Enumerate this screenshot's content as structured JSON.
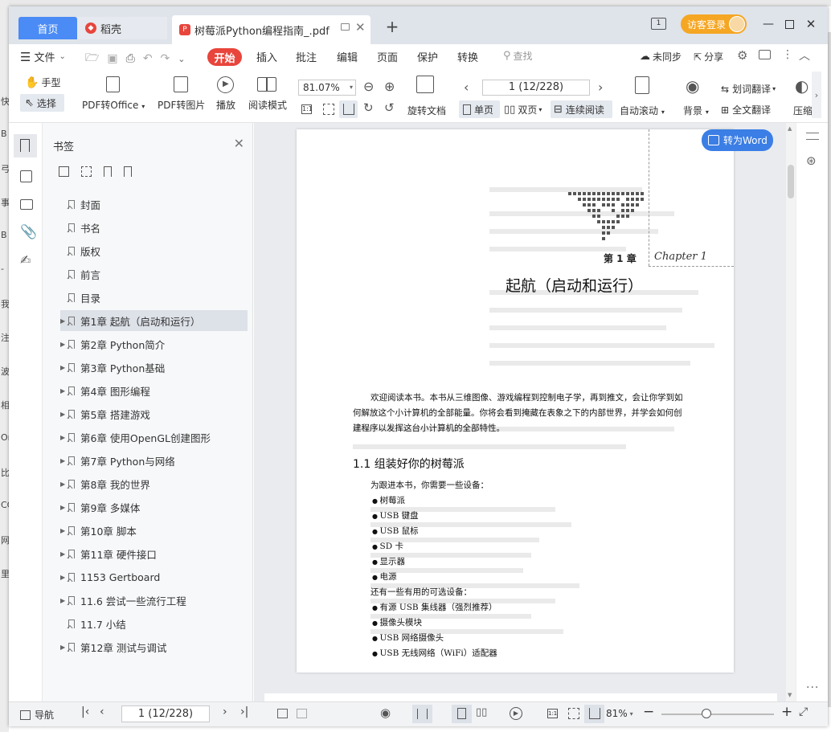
{
  "background": {
    "title_fragment": "树莓派Python编程指南",
    "side_chars": [
      "快",
      "B",
      "弓",
      "事",
      "B",
      "-",
      "我",
      "注",
      "波",
      "相",
      "Or",
      "比",
      "CC",
      "网",
      "里"
    ]
  },
  "tabs": {
    "home": "首页",
    "docer": "稻壳",
    "pdf": "树莓派Python编程指南_.pdf"
  },
  "account": {
    "visitor_label": "访客登录"
  },
  "menu": {
    "file": "文件",
    "start": "开始",
    "insert": "插入",
    "annotate": "批注",
    "edit": "编辑",
    "page": "页面",
    "protect": "保护",
    "convert": "转换",
    "search": "查找",
    "sync": "未同步",
    "share": "分享"
  },
  "toolbar": {
    "hand": "手型",
    "select": "选择",
    "pdf_to_office": "PDF转Office",
    "pdf_to_image": "PDF转图片",
    "play": "播放",
    "read_mode": "阅读模式",
    "zoom": "81.07%",
    "rotate_doc": "旋转文档",
    "page_nav": "1 (12/228)",
    "single_page": "单页",
    "double_page": "双页",
    "continuous": "连续阅读",
    "auto_scroll": "自动滚动",
    "background": "背景",
    "word_translate": "划词翻译",
    "full_translate": "全文翻译",
    "compress": "压缩"
  },
  "panel": {
    "title": "书签",
    "items": [
      {
        "label": "封面",
        "expandable": false
      },
      {
        "label": "书名",
        "expandable": false
      },
      {
        "label": "版权",
        "expandable": false
      },
      {
        "label": "前言",
        "expandable": false
      },
      {
        "label": "目录",
        "expandable": false
      },
      {
        "label": "第1章 起航（启动和运行）",
        "expandable": true,
        "active": true
      },
      {
        "label": "第2章 Python简介",
        "expandable": true
      },
      {
        "label": "第3章 Python基础",
        "expandable": true
      },
      {
        "label": "第4章 图形编程",
        "expandable": true
      },
      {
        "label": "第5章 搭建游戏",
        "expandable": true
      },
      {
        "label": "第6章 使用OpenGL创建图形",
        "expandable": true
      },
      {
        "label": "第7章 Python与网络",
        "expandable": true
      },
      {
        "label": "第8章 我的世界",
        "expandable": true
      },
      {
        "label": "第9章 多媒体",
        "expandable": true
      },
      {
        "label": "第10章 脚本",
        "expandable": true
      },
      {
        "label": "第11章 硬件接口",
        "expandable": true
      },
      {
        "label": "1153 Gertboard",
        "expandable": true
      },
      {
        "label": "11.6 尝试一些流行工程",
        "expandable": true
      },
      {
        "label": "11.7 小结",
        "expandable": false
      },
      {
        "label": "第12章 测试与调试",
        "expandable": true
      }
    ]
  },
  "document": {
    "to_word": "转为Word",
    "chapter_number": "第 1 章",
    "chapter_en": "Chapter 1",
    "chapter_title": "起航（启动和运行）",
    "intro_lines": [
      "欢迎阅读本书。本书从三维图像、游戏编程到控制电子学，再到推文，会让你学到如",
      "何解放这个小计算机的全部能量。你将会看到掩藏在表象之下的内部世界，并学会如何创",
      "建程序以发挥这台小计算机的全部特性。"
    ],
    "section_heading": "1.1   组装好你的树莓派",
    "need_text": "为跟进本书，你需要一些设备：",
    "required": [
      "树莓派",
      "USB 键盘",
      "USB 鼠标",
      "SD 卡",
      "显示器",
      "电源"
    ],
    "optional_text": "还有一些有用的可选设备：",
    "optional": [
      "有源 USB 集线器（强烈推荐）",
      "摄像头模块",
      "USB 网络摄像头",
      "USB 无线网络（WiFi）适配器"
    ]
  },
  "status": {
    "nav": "导航",
    "page": "1 (12/228)",
    "zoom": "81%"
  },
  "colors": {
    "accent_blue": "#4a8bf5",
    "start_red": "#e8453c",
    "visitor_orange": "#f5a623",
    "to_word_blue": "#3b7ee5"
  }
}
